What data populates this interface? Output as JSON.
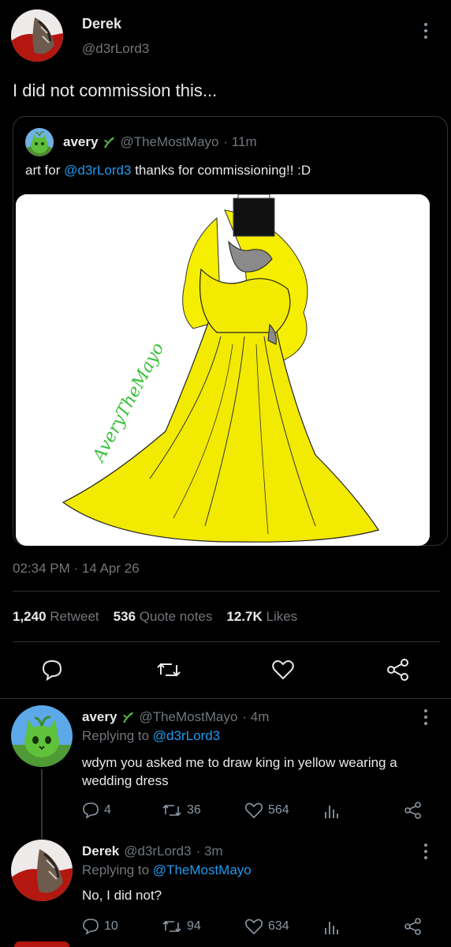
{
  "main_tweet": {
    "author_name": "Derek",
    "author_handle": "@d3rLord3",
    "text": "I did not commission this...",
    "quoted": {
      "author_name": "avery",
      "author_handle": "@TheMostMayo",
      "time": "· 11m",
      "text_before": "art for",
      "mention": "@d3rLord3",
      "text_after": "thanks for commissioning!! :D",
      "image_signature": "AveryTheMayo"
    },
    "timestamp": "02:34 PM · 14 Apr 26",
    "stats": {
      "retweets_count": "1,240",
      "retweets_label": "Retweet",
      "quotes_count": "536",
      "quotes_label": "Quote notes",
      "likes_count": "12.7K",
      "likes_label": "Likes"
    }
  },
  "replies": [
    {
      "author_name": "avery",
      "author_handle": "@TheMostMayo",
      "time": "· 4m",
      "replying_label": "Replying to",
      "replying_to": "@d3rLord3",
      "text": "wdym you asked me to draw king in yellow wearing a wedding dress",
      "replies": "4",
      "retweets": "36",
      "likes": "564"
    },
    {
      "author_name": "Derek",
      "author_handle": "@d3rLord3",
      "time": "· 3m",
      "replying_label": "Replying to",
      "replying_to": "@TheMostMayo",
      "text": "No, I did not?",
      "replies": "10",
      "retweets": "94",
      "likes": "634"
    }
  ],
  "colors": {
    "background": "#000000",
    "link": "#1d9bf0",
    "muted": "#71767b",
    "divider": "#2f3336",
    "sprout": "#57c242"
  }
}
